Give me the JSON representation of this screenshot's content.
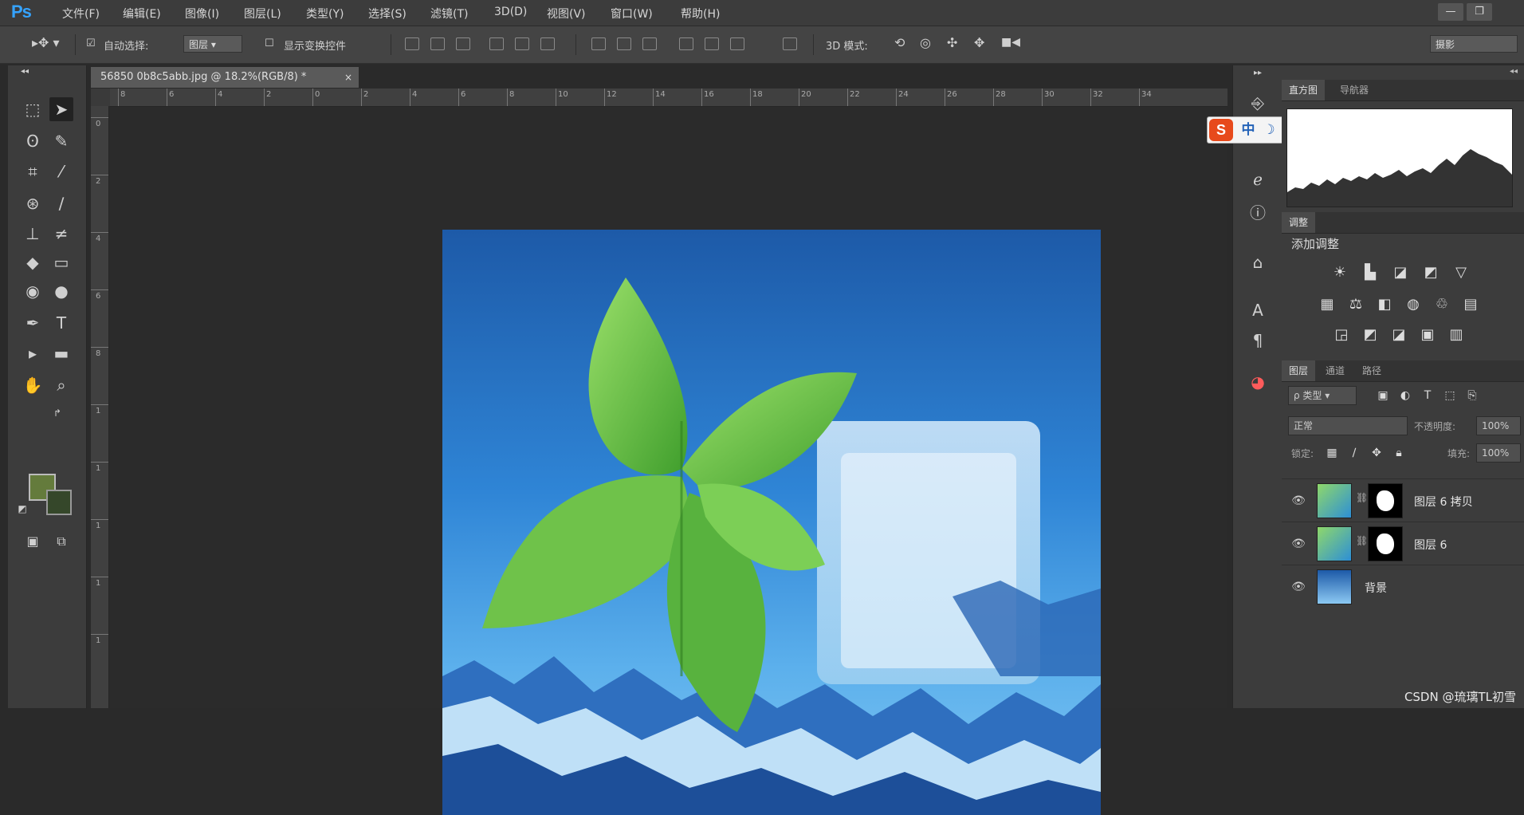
{
  "app": {
    "logo": "Ps"
  },
  "menu": [
    "文件(F)",
    "编辑(E)",
    "图像(I)",
    "图层(L)",
    "类型(Y)",
    "选择(S)",
    "滤镜(T)",
    "3D(D)",
    "视图(V)",
    "窗口(W)",
    "帮助(H)"
  ],
  "window_controls": {
    "minimize": "—",
    "restore": "❐"
  },
  "options_bar": {
    "auto_select_label": "自动选择:",
    "auto_select_target": "图层",
    "show_transform_label": "显示变换控件",
    "mode_3d_label": "3D 模式:",
    "workspace": "摄影"
  },
  "document": {
    "tab_title": "56850 0b8c5abb.jpg @ 18.2%(RGB/8) *",
    "close": "×"
  },
  "ruler": {
    "h_labels": [
      "8",
      "6",
      "4",
      "2",
      "0",
      "2",
      "4",
      "6",
      "8",
      "10",
      "12",
      "14",
      "16",
      "18",
      "20",
      "22",
      "24",
      "26",
      "28",
      "30",
      "32",
      "34"
    ],
    "v_labels": [
      "0",
      "2",
      "4",
      "6",
      "8",
      "1",
      "1",
      "1",
      "1",
      "1"
    ]
  },
  "colors": {
    "foreground": "#647b3c",
    "background": "#35472a",
    "canvas_top": "#1d5aa8",
    "canvas_bottom": "#7fc6f2",
    "accent": "#35a3ff"
  },
  "panels": {
    "histogram_tabs": [
      "直方图",
      "导航器"
    ],
    "adjustments_tab": "调整",
    "adjustments_title": "添加调整",
    "layers_tabs": [
      "图层",
      "通道",
      "路径"
    ],
    "filter_kind": "ρ 类型",
    "blend_mode": "正常",
    "opacity_label": "不透明度:",
    "opacity_value": "100%",
    "lock_label": "锁定:",
    "fill_label": "填充:",
    "fill_value": "100%"
  },
  "layers": [
    {
      "name": "图层 6 拷贝",
      "visible": true
    },
    {
      "name": "图层 6",
      "visible": true
    },
    {
      "name": "背景",
      "visible": true
    }
  ],
  "ime_toolbar": {
    "logo": "S",
    "mode": "中"
  },
  "watermark": "CSDN @琉璃TL初雪"
}
